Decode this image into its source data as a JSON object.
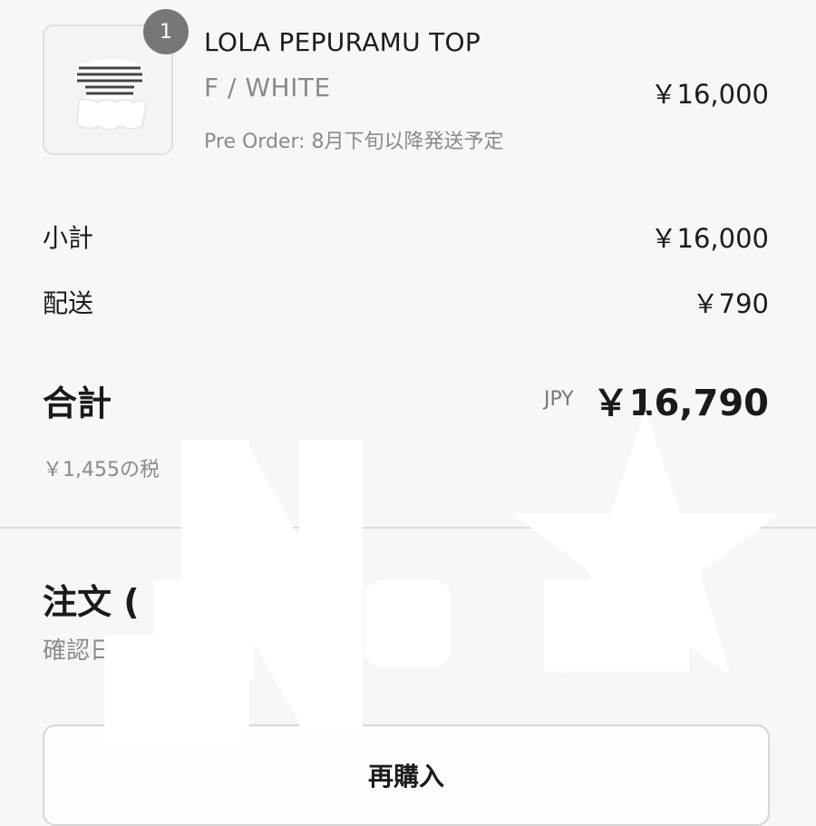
{
  "cart_item": {
    "quantity": "1",
    "name": "LOLA PEPURAMU TOP",
    "variant": "F / WHITE",
    "note": "Pre Order: 8月下旬以降発送予定",
    "price": "￥16,000",
    "image_icon": "product-thumbnail"
  },
  "summary": {
    "subtotal_label": "小計",
    "subtotal_value": "￥16,000",
    "shipping_label": "配送",
    "shipping_value": "￥790",
    "total_label": "合計",
    "total_currency": "JPY",
    "total_value": "￥16,790",
    "tax_note": "￥1,455の税"
  },
  "order": {
    "heading": "注文 (",
    "date_label": "確認日: 6"
  },
  "actions": {
    "rebuy_label": "再購入"
  },
  "colors": {
    "background": "#f7f7f7",
    "muted_text": "#8a8a8a",
    "badge": "#777777"
  }
}
